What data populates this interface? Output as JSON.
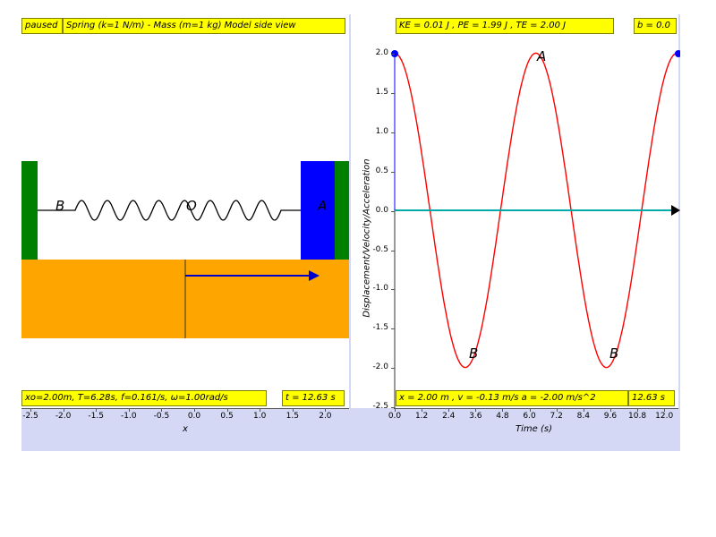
{
  "left": {
    "paused_label": "paused",
    "title": "Spring (k=1 N/m) - Mass (m=1 kg) Model side view",
    "info": "xo=2.00m, T=6.28s, f=0.161/s, ω=1.00rad/s",
    "time": "t = 12.63 s",
    "x_axis_title": "x",
    "x_ticks": [
      "-2.5",
      "-2.0",
      "-1.5",
      "-1.0",
      "-0.5",
      "0.0",
      "0.5",
      "1.0",
      "1.5",
      "2.0"
    ],
    "markers": {
      "b": "B",
      "o": "O",
      "a": "A"
    },
    "colors": {
      "wall": "#008000",
      "spring": "#000000",
      "mass": "#0000ff",
      "floor": "#ffa500",
      "arrow": "#0000cc"
    }
  },
  "right": {
    "energy": "KE = 0.01 J , PE = 1.99 J , TE = 2.00 J",
    "damping": "b = 0.0",
    "readout": "x = 2.00 m , v = -0.13 m/s a = -2.00 m/s^2",
    "time": "12.63 s",
    "y_axis_title": "Displacement/Velocity/Acceleration",
    "x_axis_title": "Time (s)",
    "y_ticks": [
      "2.0",
      "1.5",
      "1.0",
      "0.5",
      "0.0",
      "-0.5",
      "-1.0",
      "-1.5",
      "-2.0",
      "-2.5"
    ],
    "x_ticks": [
      "0.0",
      "1.2",
      "2.4",
      "3.6",
      "4.8",
      "6.0",
      "7.2",
      "8.4",
      "9.6",
      "10.8",
      "12.0"
    ],
    "markers": {
      "a": "A",
      "b1": "B",
      "b2": "B"
    },
    "colors": {
      "displacement": "#ff0000",
      "velocity": "#00aaaa",
      "point": "#0000ff"
    }
  },
  "chart_data": {
    "type": "line",
    "xlabel": "Time (s)",
    "ylabel": "Displacement/Velocity/Acceleration",
    "xlim": [
      0,
      12.63
    ],
    "ylim": [
      -2.5,
      2.0
    ],
    "series": [
      {
        "name": "x",
        "function": "2*cos(t)",
        "color": "#ff0000"
      },
      {
        "name": "v",
        "values_constant": 0.0,
        "color": "#00aaaa"
      }
    ]
  }
}
